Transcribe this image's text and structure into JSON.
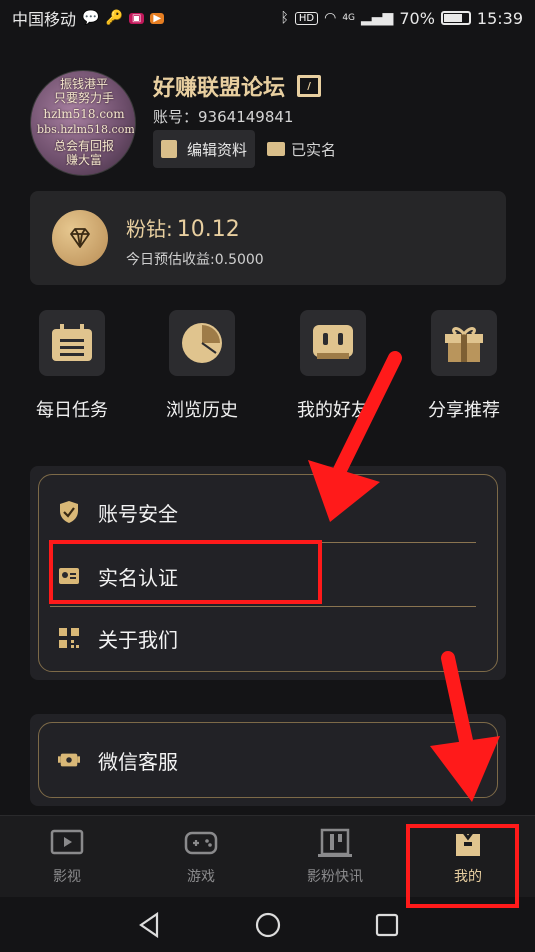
{
  "status_bar": {
    "carrier": "中国移动",
    "network": "4G",
    "hd": "HD",
    "battery": "70%",
    "time": "15:39"
  },
  "profile": {
    "avatar_text": [
      "振钱港平",
      "只要努力手",
      "hzlm518.com",
      "bbs.hzlm518.com",
      "总会有回报",
      "赚大富"
    ],
    "username": "好赚联盟论坛",
    "account_label": "账号：",
    "account_id": "9364149841",
    "edit_button": "编辑资料",
    "verified_label": "已实名"
  },
  "wallet": {
    "coin_label": "粉钻:",
    "coin_value": "10.12",
    "estimate": "今日预估收益:0.5000"
  },
  "shortcuts": [
    {
      "label": "每日任务",
      "icon": "calendar-icon"
    },
    {
      "label": "浏览历史",
      "icon": "pie-clock-icon"
    },
    {
      "label": "我的好友",
      "icon": "chat-face-icon"
    },
    {
      "label": "分享推荐",
      "icon": "gift-icon"
    }
  ],
  "menu": [
    {
      "label": "账号安全",
      "icon": "shield-check-icon"
    },
    {
      "label": "实名认证",
      "icon": "id-card-icon"
    },
    {
      "label": "关于我们",
      "icon": "qr-code-icon"
    }
  ],
  "service": {
    "label": "微信客服",
    "icon": "headset-icon"
  },
  "tabs": [
    {
      "label": "影视",
      "icon": "video-icon",
      "active": false
    },
    {
      "label": "游戏",
      "icon": "gamepad-icon",
      "active": false
    },
    {
      "label": "影粉快讯",
      "icon": "news-icon",
      "active": false
    },
    {
      "label": "我的",
      "icon": "profile-icon",
      "active": true
    }
  ],
  "colors": {
    "accent_gold": "#e8cfa0",
    "annotation_red": "#ff1a1a",
    "background": "#141416"
  }
}
